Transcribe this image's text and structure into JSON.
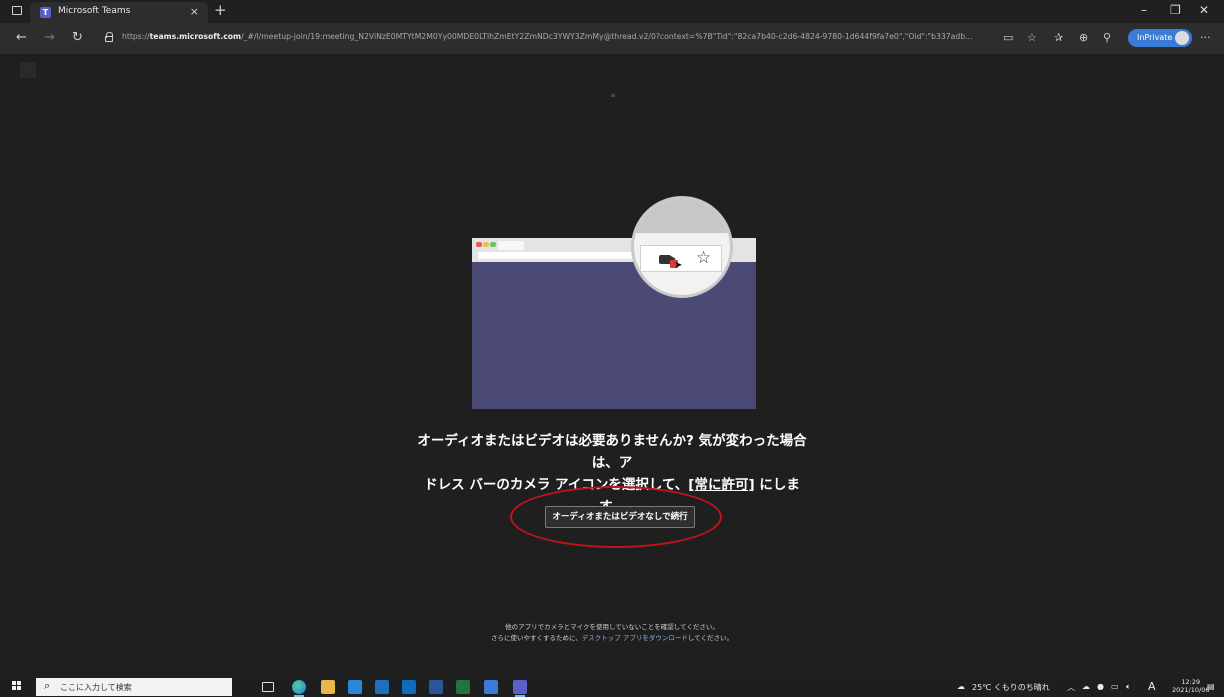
{
  "browser": {
    "tab_title": "Microsoft Teams",
    "tab_close": "×",
    "new_tab": "+",
    "url_prefix": "https://",
    "url_host": "teams.microsoft.com",
    "url_rest": "/_#/l/meetup-join/19:meeting_N2ViNzE0MTYtM2M0Yy00MDE0LTlhZmEtY2ZmNDc3YWY3ZmMy@thread.v2/0?context=%7B\"Tid\":\"82ca7b40-c2d6-4824-9780-1d644f9fa7e0\",\"Oid\":\"b337adb...",
    "inprivate_label": "InPrivate",
    "more_label": "···",
    "window_controls": {
      "minimize": "–",
      "restore": "❐",
      "close": "✕"
    }
  },
  "page": {
    "message_line1": "オーディオまたはビデオは必要ありませんか? 気が変わった場合は、ア",
    "message_line2_a": "ドレス バーのカメラ アイコンを選択して、",
    "message_line2_link": "[常に許可]",
    "message_line2_b": " にします。",
    "continue_button": "オーディオまたはビデオなしで続行",
    "footnote_line1": "他のアプリでカメラとマイクを使用していないことを確認してください。",
    "footnote_line2_a": "さらに使いやすくするために、",
    "footnote_line2_link": "デスクトップ アプリをダウンロード",
    "footnote_line2_b": "してください。"
  },
  "taskbar": {
    "search_placeholder": "ここに入力して検索",
    "weather": "25℃ くもりのち晴れ",
    "ime": "A",
    "time": "12:29",
    "date": "2021/10/06"
  },
  "colors": {
    "page_bg": "#1f1f1f",
    "illustration_window": "#4a4a75",
    "highlight_oval": "#c0141c",
    "inprivate": "#3a7bd5"
  }
}
